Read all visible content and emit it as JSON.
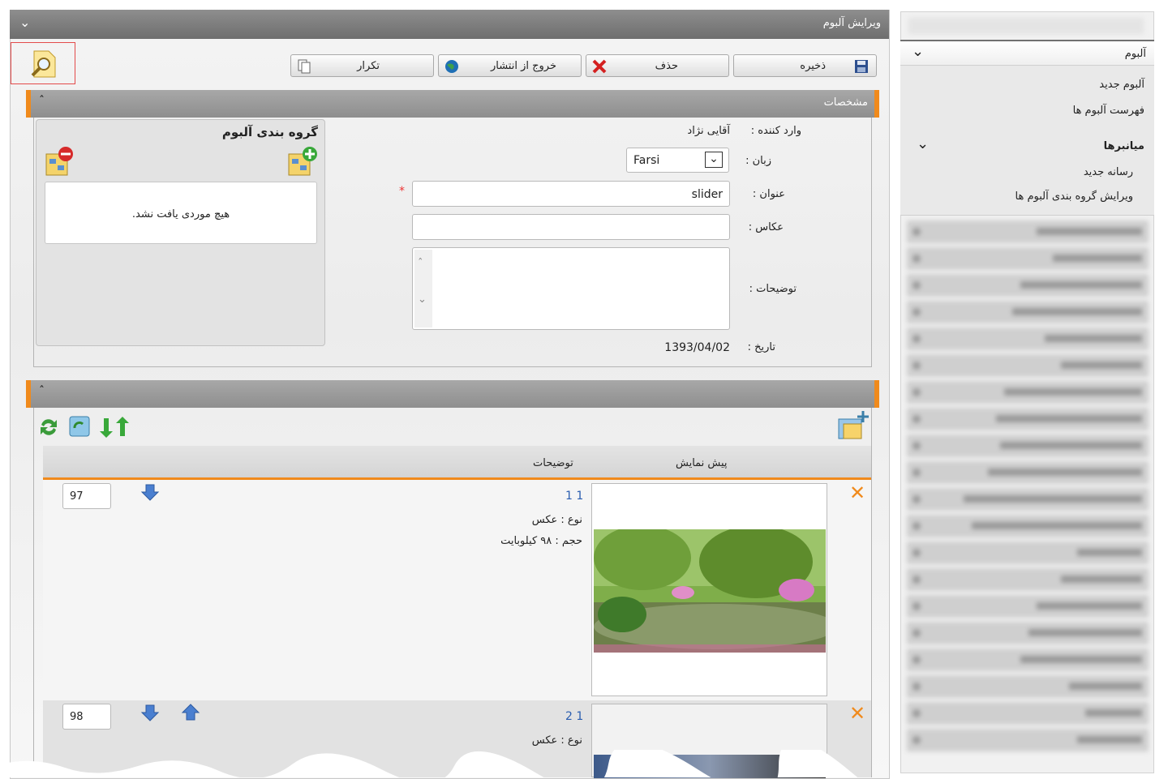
{
  "window": {
    "title": "ویرایش آلبوم"
  },
  "toolbar": {
    "save": "ذخیره",
    "delete": "حذف",
    "unpublish": "خروج از انتشار",
    "duplicate": "تکرار"
  },
  "details": {
    "header": "مشخصات",
    "creator_label": "وارد کننده  :",
    "creator_value": "آقایی نژاد",
    "language_label": "زبان  :",
    "language_value": "Farsi",
    "title_label": "عنوان  :",
    "title_value": "slider",
    "required_mark": "*",
    "photographer_label": "عکاس  :",
    "photographer_value": "",
    "description_label": "توضیحات  :",
    "date_label": "تاریخ  :",
    "date_value": "1393/04/02"
  },
  "grouping": {
    "title": "گروه بندی آلبوم",
    "empty_text": "هیچ موردی یافت نشد."
  },
  "media": {
    "columns": {
      "preview": "پیش نمایش",
      "description": "توضیحات"
    },
    "items": [
      {
        "title": "1 1",
        "type": "نوع : عکس",
        "size": "حجم : ۹۸ کیلوبایت",
        "order": "97"
      },
      {
        "title": "2 1",
        "type": "نوع : عکس",
        "size": "",
        "order": "98"
      }
    ]
  },
  "sidebar": {
    "section_album": "آلبوم",
    "items": [
      "آلبوم جدید",
      "فهرست آلبوم ها"
    ],
    "section_shortcuts": "میانبرها",
    "shortcut_items": [
      "رسانه جدید",
      "ویرایش گروه بندی آلبوم ها"
    ]
  },
  "colors": {
    "accent": "#f08a1c",
    "titlebar": "#7a7a7a",
    "link": "#2a5db0"
  }
}
